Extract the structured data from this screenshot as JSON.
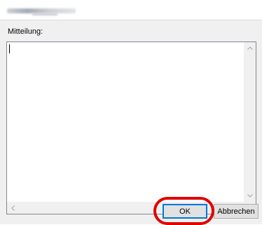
{
  "dialog": {
    "title": ""
  },
  "message": {
    "label": "Mitteilung:",
    "value": ""
  },
  "buttons": {
    "ok_label": "OK",
    "cancel_label": "Abbrechen"
  },
  "icons": {
    "scroll_up": "chevron-up-icon",
    "scroll_down": "chevron-down-icon",
    "scroll_left": "chevron-left-icon",
    "scroll_right": "chevron-right-icon"
  },
  "colors": {
    "highlight": "#e00000",
    "focus_border": "#0078d7"
  }
}
